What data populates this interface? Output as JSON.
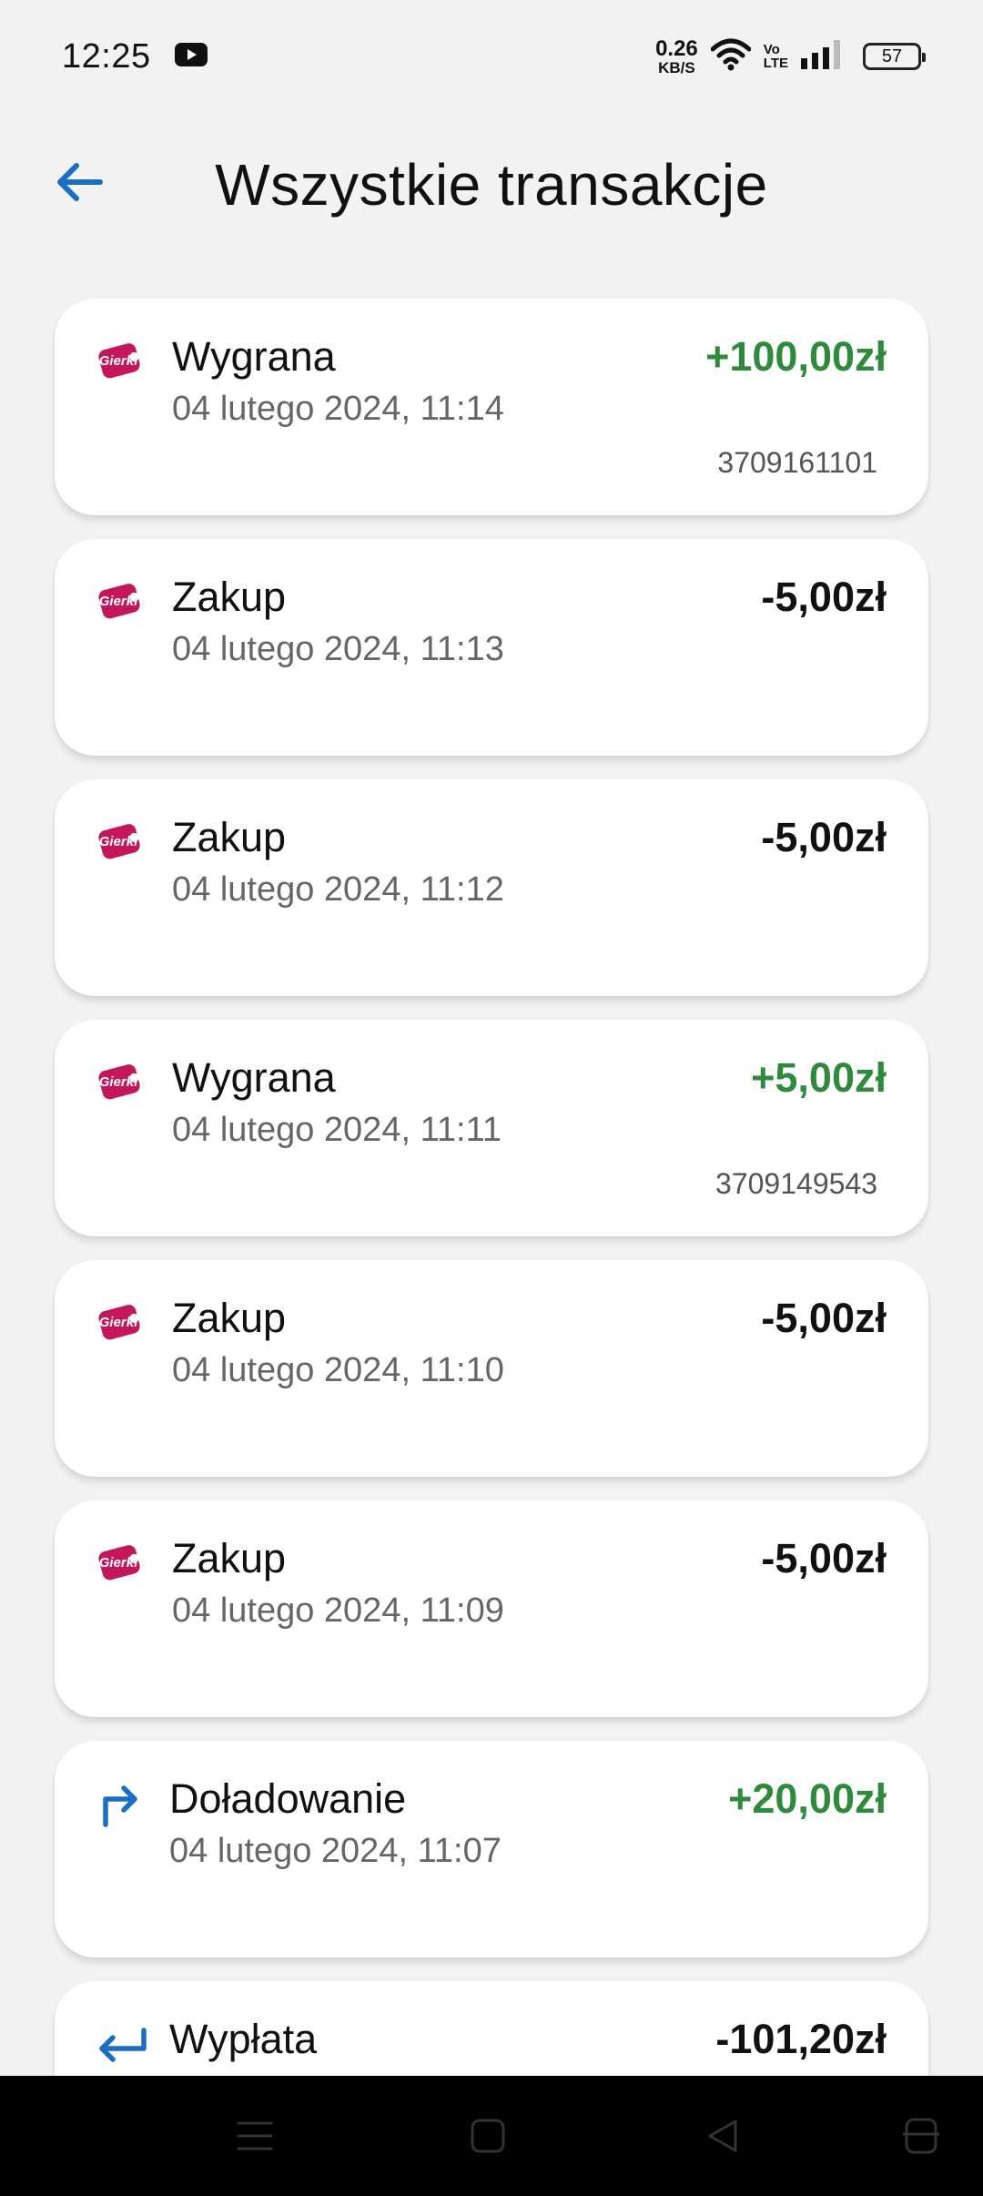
{
  "status_bar": {
    "time": "12:25",
    "net_speed_value": "0.26",
    "net_speed_unit": "KB/S",
    "volte_top": "Vo",
    "volte_bottom": "LTE",
    "battery": "57"
  },
  "header": {
    "title": "Wszystkie transakcje"
  },
  "colors": {
    "positive": "#2f8a3c",
    "negative": "#111111",
    "accent_blue": "#1a6fc4",
    "gierki_pink": "#c2185b"
  },
  "transactions": [
    {
      "icon": "gierki-logo-icon",
      "title": "Wygrana",
      "date": "04 lutego 2024, 11:14",
      "amount": "+100,00zł",
      "sign": "pos",
      "ticket": "3709161101"
    },
    {
      "icon": "gierki-logo-icon",
      "title": "Zakup",
      "date": "04 lutego 2024, 11:13",
      "amount": "-5,00zł",
      "sign": "neg",
      "ticket": ""
    },
    {
      "icon": "gierki-logo-icon",
      "title": "Zakup",
      "date": "04 lutego 2024, 11:12",
      "amount": "-5,00zł",
      "sign": "neg",
      "ticket": ""
    },
    {
      "icon": "gierki-logo-icon",
      "title": "Wygrana",
      "date": "04 lutego 2024, 11:11",
      "amount": "+5,00zł",
      "sign": "pos",
      "ticket": "3709149543"
    },
    {
      "icon": "gierki-logo-icon",
      "title": "Zakup",
      "date": "04 lutego 2024, 11:10",
      "amount": "-5,00zł",
      "sign": "neg",
      "ticket": ""
    },
    {
      "icon": "gierki-logo-icon",
      "title": "Zakup",
      "date": "04 lutego 2024, 11:09",
      "amount": "-5,00zł",
      "sign": "neg",
      "ticket": ""
    },
    {
      "icon": "top-up-arrow-icon",
      "title": "Doładowanie",
      "date": "04 lutego 2024, 11:07",
      "amount": "+20,00zł",
      "sign": "pos",
      "ticket": ""
    },
    {
      "icon": "withdraw-arrow-icon",
      "title": "Wypłata",
      "date": "",
      "amount": "-101,20zł",
      "sign": "neg",
      "ticket": ""
    }
  ],
  "gierki_logo_text": "Gierki"
}
